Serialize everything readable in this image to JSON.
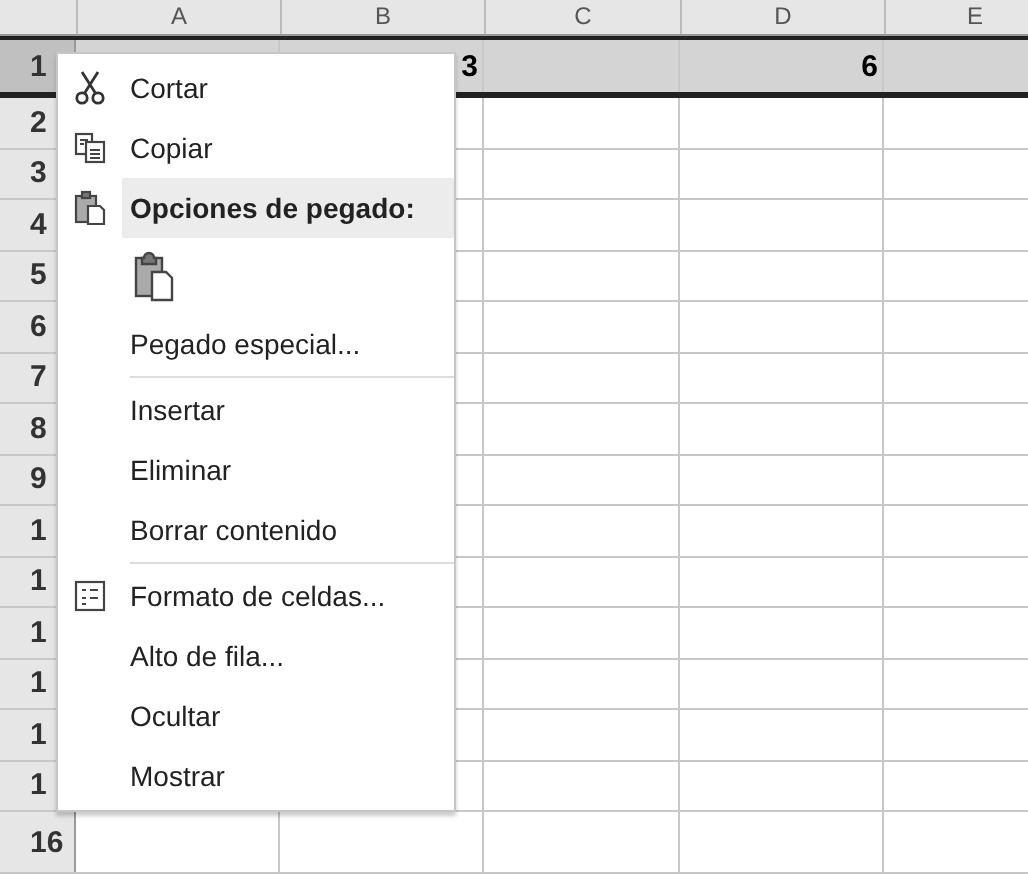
{
  "sheet": {
    "columns": [
      "A",
      "B",
      "C",
      "D",
      "E"
    ],
    "rows": [
      {
        "header": "1",
        "selected": true,
        "cells": [
          null,
          "3",
          null,
          "6",
          null
        ]
      },
      {
        "header": "2",
        "selected": false
      },
      {
        "header": "3",
        "selected": false
      },
      {
        "header": "4",
        "selected": false
      },
      {
        "header": "5",
        "selected": false
      },
      {
        "header": "6",
        "selected": false
      },
      {
        "header": "7",
        "selected": false
      },
      {
        "header": "8",
        "selected": false
      },
      {
        "header": "9",
        "selected": false
      },
      {
        "header": "1",
        "selected": false
      },
      {
        "header": "1",
        "selected": false
      },
      {
        "header": "1",
        "selected": false
      },
      {
        "header": "1",
        "selected": false
      },
      {
        "header": "1",
        "selected": false
      },
      {
        "header": "1",
        "selected": false
      },
      {
        "header": "16",
        "selected": false
      }
    ]
  },
  "context_menu": {
    "items": [
      {
        "kind": "item",
        "label": "Cortar"
      },
      {
        "kind": "item",
        "label": "Copiar"
      },
      {
        "kind": "heading",
        "label": "Opciones de pegado:"
      },
      {
        "kind": "paste-options"
      },
      {
        "kind": "item",
        "label": "Pegado especial..."
      },
      {
        "kind": "separator"
      },
      {
        "kind": "item",
        "label": "Insertar"
      },
      {
        "kind": "item",
        "label": "Eliminar"
      },
      {
        "kind": "item",
        "label": "Borrar contenido"
      },
      {
        "kind": "separator"
      },
      {
        "kind": "item",
        "label": "Formato de celdas..."
      },
      {
        "kind": "item",
        "label": "Alto de fila..."
      },
      {
        "kind": "item",
        "label": "Ocultar"
      },
      {
        "kind": "item",
        "label": "Mostrar"
      }
    ]
  }
}
